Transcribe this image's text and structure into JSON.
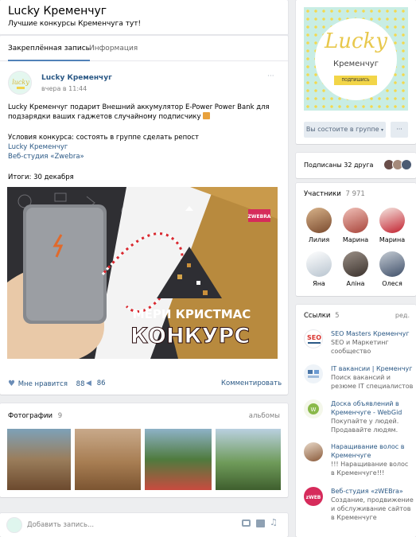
{
  "header": {
    "title": "Lucky Кременчуг",
    "status": "Лучшие конкурсы Кременчуга тут!"
  },
  "tabs": [
    {
      "label": "Закреплённая запись"
    },
    {
      "label": "Информация"
    }
  ],
  "post": {
    "author": "Lucky Кременчуг",
    "time": "вчера в 11:44",
    "more": "···",
    "line1": "Lucky Кременчуг подарит Внешний аккумулятор E-Power Power Bank для",
    "line2": "подзарядки ваших гаджетов случайному подписчику",
    "line3": "Условия конкурса: состоять в группе сделать репост",
    "link1": "Lucky Кременчуг",
    "link2": "Веб-студия «Zwebra»",
    "line4": "Итоги: 30 декабря",
    "image_text_1": "МЕРИ КРИСТМАС",
    "image_text_2": "КОНКУРС",
    "image_logo": "ZWEBRA",
    "like_label": "Мне нравится",
    "like_count": "88",
    "share_count": "86",
    "comment_label": "Комментировать"
  },
  "photos": {
    "title": "Фотографии",
    "count": "9",
    "all_label": "альбомы"
  },
  "composer": {
    "placeholder": "Добавить запись..."
  },
  "cover": {
    "logo_word": "Lucky",
    "logo_city": "Кременчуг",
    "logo_sub": "ПОДПИШИСЬ",
    "member_button": "Вы состоите в группе",
    "more": "···"
  },
  "subscribed": {
    "text": "Подписаны 32 друга"
  },
  "members": {
    "title": "Участники",
    "count": "7 971",
    "people": [
      {
        "name": "Лилия"
      },
      {
        "name": "Марина"
      },
      {
        "name": "Марина"
      },
      {
        "name": "Яна"
      },
      {
        "name": "Аліна"
      },
      {
        "name": "Олеся"
      }
    ]
  },
  "links": {
    "title": "Ссылки",
    "count": "5",
    "edit": "ред.",
    "items": [
      {
        "title": "SEO Masters Кременчуг",
        "desc": "SEO и Маркетинг сообщество"
      },
      {
        "title": "IT вакансии | Кременчуг",
        "desc": "Поиск вакансий и резюме IT специалистов"
      },
      {
        "title": "Доска объявлений в Кременчуге - WebGid",
        "desc": "Покупайте у людей. Продавайте людям."
      },
      {
        "title": "Наращивание волос в Кременчуге",
        "desc": "!!! Наращивание волос в Кременчуге!!!"
      },
      {
        "title": "Веб-студия «zWEBra»",
        "desc": "Создание, продвижение и обслуживание сайтов в Кременчуге"
      }
    ]
  },
  "colors": {
    "accent": "#2a5885",
    "bg": "#edeef0",
    "button": "#e5ebf1"
  }
}
